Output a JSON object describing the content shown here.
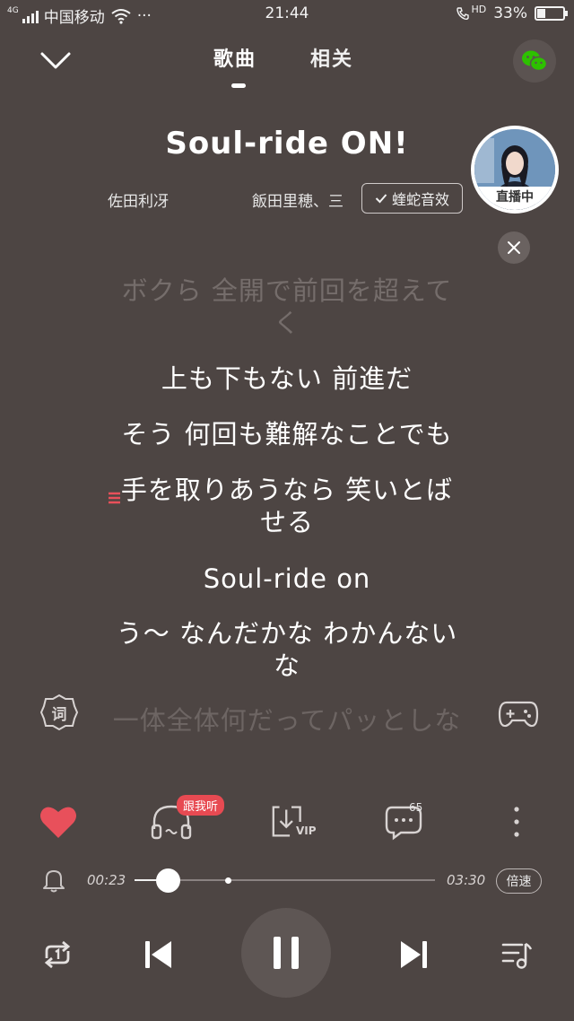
{
  "status_bar": {
    "network_tag": "4G",
    "carrier": "中国移动",
    "more": "···",
    "time": "21:44",
    "hd_label": "HD",
    "battery": "33%",
    "battery_level": 0.33
  },
  "header": {
    "tabs": [
      {
        "label": "歌曲",
        "active": true
      },
      {
        "label": "相关",
        "active": false
      }
    ]
  },
  "song": {
    "title": "Soul-ride ON!",
    "artist_left": "佐田利冴",
    "artist_right": "飯田里穂、三",
    "source_label": "蝰蛇音效"
  },
  "live": {
    "label": "直播中"
  },
  "lyrics": [
    {
      "lines": [
        "ボクら 全開で前回を超えて",
        "く"
      ],
      "state": "past"
    },
    {
      "lines": [
        "上も下もない 前進だ"
      ],
      "state": "normal"
    },
    {
      "lines": [
        "そう 何回も難解なことでも"
      ],
      "state": "normal"
    },
    {
      "lines": [
        "手を取りあうなら 笑いとば",
        "せる"
      ],
      "state": "current"
    },
    {
      "lines": [
        "Soul-ride on"
      ],
      "state": "normal"
    },
    {
      "lines": [
        "う～ なんだかな わかんない",
        "な"
      ],
      "state": "normal"
    },
    {
      "lines": [
        "一体全体何だってパッとしな"
      ],
      "state": "fade"
    }
  ],
  "side_buttons": {
    "lyric_icon_label": "词"
  },
  "actions": {
    "follow_badge": "跟我听",
    "comment_count": "65",
    "vip_label": "VIP"
  },
  "progress": {
    "current": "00:23",
    "total": "03:30",
    "played_fraction": 0.11,
    "buffered_fraction": 0.31,
    "speed_label": "倍速"
  },
  "colors": {
    "background": "#4d4543",
    "like": "#e8505b",
    "badge": "#e74a52",
    "lyric_mark": "#e8505b",
    "wechat": "#2dc100"
  },
  "icons": [
    "signal-icon",
    "wifi-icon",
    "call-hd-icon",
    "battery-icon",
    "chevron-down-icon",
    "wechat-icon",
    "check-icon",
    "close-icon",
    "lyric-icon",
    "gamepad-icon",
    "heart-icon",
    "listen-together-icon",
    "download-vip-icon",
    "comment-icon",
    "more-icon",
    "bell-icon",
    "repeat-one-icon",
    "prev-icon",
    "pause-icon",
    "next-icon",
    "playlist-icon"
  ]
}
